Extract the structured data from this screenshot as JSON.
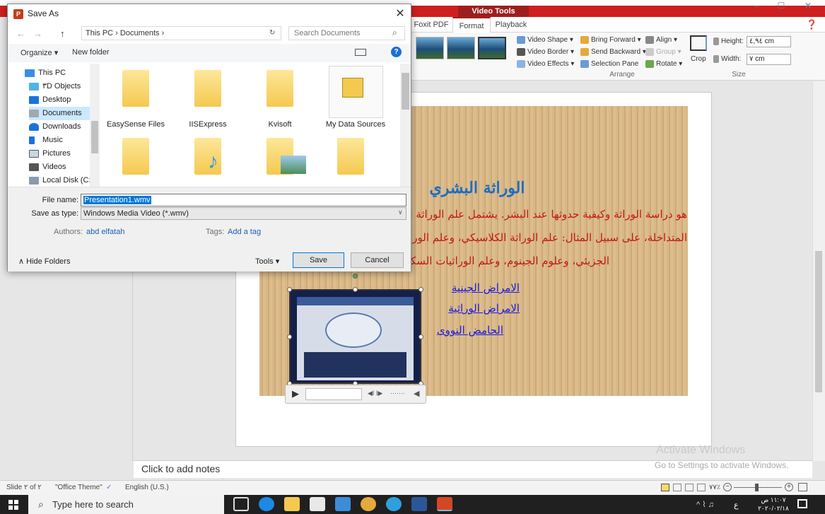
{
  "powerpoint": {
    "window_controls": [
      "–",
      "☐",
      "✕"
    ],
    "contextual_tab": "Video Tools",
    "tabs": [
      "Foxit PDF",
      "Format",
      "Playback"
    ],
    "ribbon": {
      "video_shape": "Video Shape ▾",
      "video_border": "Video Border ▾",
      "video_effects": "Video Effects ▾",
      "bring_forward": "Bring Forward ▾",
      "send_backward": "Send Backward ▾",
      "selection_pane": "Selection Pane",
      "align": "Align ▾",
      "group": "Group ▾",
      "rotate": "Rotate ▾",
      "crop": "Crop",
      "height_label": "Height:",
      "height_value": "٤,٩٤ cm",
      "width_label": "Width:",
      "width_value": "٧ cm",
      "arrange_label": "Arrange",
      "size_label": "Size"
    },
    "slide": {
      "title": "الوراثة البشري",
      "line1": "هو دراسة الوراثة وكيفية حدوثها عند البشر. يشتمل علم الوراثة البشـ",
      "line2": "المتداخلة، على سبيل المثال: علم الوراثة الكلاسيكي، وعلم الوراثة الخلو",
      "line3": "الجزيئي، وعلوم الجينوم، وعلم الوراثيات السكانية، و",
      "links": [
        "الامراض الجينية",
        "الامراض الوراثية",
        "الحامض النووى"
      ]
    },
    "video_controls": {
      "play": "▶",
      "seek": "◀I I▶",
      "dots": "·······",
      "volume": "◀"
    },
    "notes_placeholder": "Click to add notes",
    "watermark_line1": "Activate Windows",
    "watermark_line2": "Go to Settings to activate Windows.",
    "status": {
      "slide_info": "Slide ٢ of ٢",
      "theme": "\"Office Theme\"",
      "language": "English (U.S.)",
      "zoom": "٧٧٪"
    }
  },
  "dialog": {
    "title": "Save As",
    "close": "✕",
    "nav_back": "←",
    "nav_forward": "→",
    "nav_up": "↑",
    "path": "This PC  ›  Documents  ›",
    "search_placeholder": "Search Documents",
    "organize": "Organize ▾",
    "new_folder": "New folder",
    "nav_items": [
      "This PC",
      "٣D Objects",
      "Desktop",
      "Documents",
      "Downloads",
      "Music",
      "Pictures",
      "Videos",
      "Local Disk (C:)"
    ],
    "folders": [
      "EasySense Files",
      "IISExpress",
      "Kvisoft",
      "My Data Sources"
    ],
    "file_name_label": "File name:",
    "file_name": "Presentation1.wmv",
    "save_type_label": "Save as type:",
    "save_type": "Windows Media Video (*.wmv)",
    "authors_label": "Authors:",
    "authors_value": "abd elfatah",
    "tags_label": "Tags:",
    "tags_value": "Add a tag",
    "hide_folders": "Hide Folders",
    "tools": "Tools",
    "save": "Save",
    "cancel": "Cancel"
  },
  "taskbar": {
    "search_placeholder": "Type here to search",
    "time": "١١:٠٧ ص",
    "date": "٢٠٢٠/٠٢/١٨",
    "lang": "ع"
  }
}
